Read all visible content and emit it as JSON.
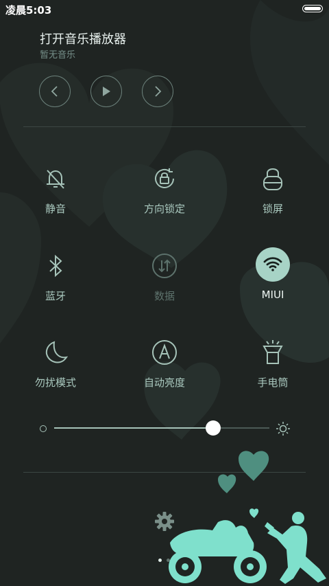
{
  "status_bar": {
    "time": "凌晨5:03",
    "battery_level": 1.0
  },
  "music": {
    "title": "打开音乐播放器",
    "subtitle": "暂无音乐"
  },
  "toggles": [
    {
      "label": "静音",
      "icon": "bell-off-icon",
      "state": "on"
    },
    {
      "label": "方向锁定",
      "icon": "rotation-lock-icon",
      "state": "on"
    },
    {
      "label": "锁屏",
      "icon": "lock-icon",
      "state": "on"
    },
    {
      "label": "蓝牙",
      "icon": "bluetooth-icon",
      "state": "on"
    },
    {
      "label": "数据",
      "icon": "mobile-data-icon",
      "state": "disabled"
    },
    {
      "label": "MIUI",
      "icon": "wifi-icon",
      "state": "active"
    },
    {
      "label": "勿扰模式",
      "icon": "moon-icon",
      "state": "on"
    },
    {
      "label": "自动亮度",
      "icon": "auto-brightness-icon",
      "state": "on"
    },
    {
      "label": "手电筒",
      "icon": "flashlight-icon",
      "state": "on"
    }
  ],
  "brightness": {
    "value": 0.74
  },
  "pager": {
    "pages": 2,
    "current": 1
  },
  "colors": {
    "background": "#1f2422",
    "accent": "#a7d3c6",
    "text": "#a6c3b9",
    "illustration": "#7fe0cc"
  }
}
